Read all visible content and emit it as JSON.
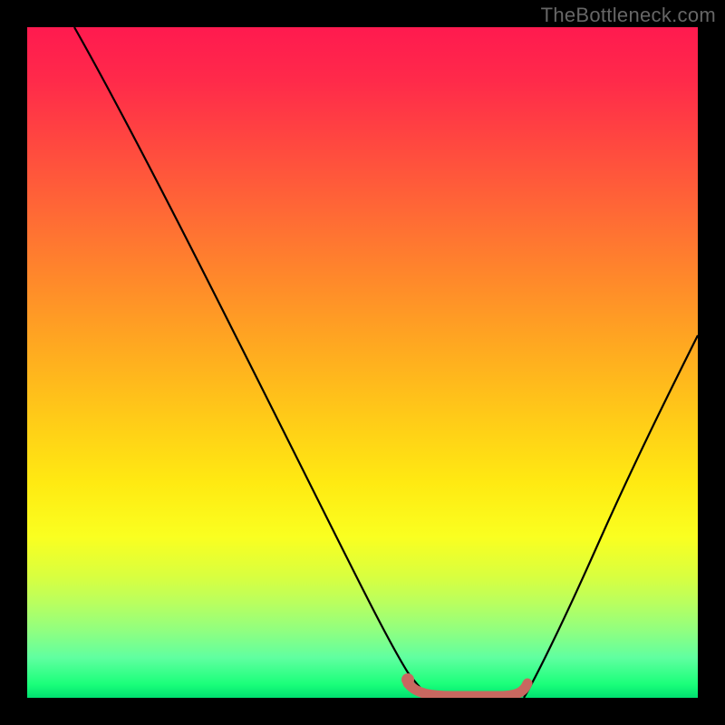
{
  "watermark": "TheBottleneck.com",
  "chart_data": {
    "type": "line",
    "title": "",
    "xlabel": "",
    "ylabel": "",
    "xlim": [
      0,
      100
    ],
    "ylim": [
      0,
      100
    ],
    "series": [
      {
        "name": "curve-left",
        "x": [
          7,
          25,
          40,
          50,
          56,
          60
        ],
        "y": [
          100,
          62,
          30,
          10,
          2,
          0
        ],
        "color": "#000000"
      },
      {
        "name": "curve-right",
        "x": [
          74,
          80,
          88,
          94,
          100
        ],
        "y": [
          0,
          10,
          28,
          42,
          55
        ],
        "color": "#000000"
      },
      {
        "name": "floor-segment",
        "x": [
          56,
          60,
          64,
          68,
          72,
          74
        ],
        "y": [
          1,
          0,
          0,
          0,
          0,
          1
        ],
        "color": "#c86860"
      }
    ],
    "markers": [
      {
        "name": "dot-left",
        "x": 56.5,
        "y": 2,
        "color": "#c86860"
      }
    ],
    "gradient_stops": [
      {
        "pos": 0,
        "color": "#ff1a4f"
      },
      {
        "pos": 50,
        "color": "#ffca18"
      },
      {
        "pos": 80,
        "color": "#faff20"
      },
      {
        "pos": 100,
        "color": "#00e070"
      }
    ]
  }
}
